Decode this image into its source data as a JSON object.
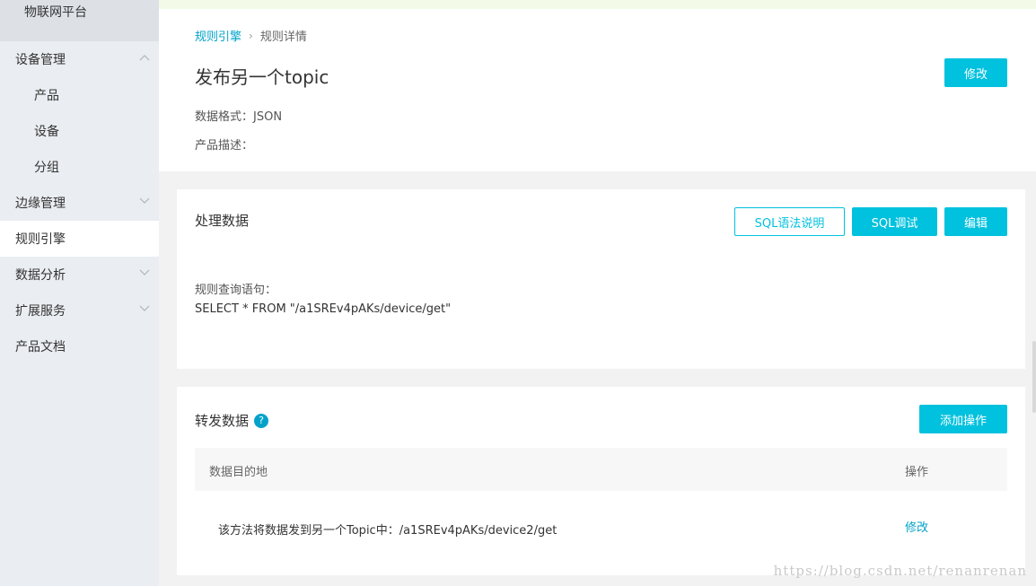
{
  "sidebar": {
    "platform_title": "物联网平台",
    "items": [
      {
        "label": "设备管理",
        "expandable": true,
        "expanded": true
      },
      {
        "label": "产品",
        "sub": true
      },
      {
        "label": "设备",
        "sub": true
      },
      {
        "label": "分组",
        "sub": true
      },
      {
        "label": "边缘管理",
        "expandable": true,
        "expanded": false
      },
      {
        "label": "规则引擎",
        "active": true
      },
      {
        "label": "数据分析",
        "expandable": true,
        "expanded": false
      },
      {
        "label": "扩展服务",
        "expandable": true,
        "expanded": false
      },
      {
        "label": "产品文档"
      }
    ]
  },
  "breadcrumb": {
    "root": "规则引擎",
    "separator": "›",
    "current": "规则详情"
  },
  "rule": {
    "title": "发布另一个topic",
    "edit_label": "修改",
    "data_format": "数据格式：JSON",
    "description": "产品描述："
  },
  "process": {
    "title": "处理数据",
    "sql_help_label": "SQL语法说明",
    "sql_debug_label": "SQL调试",
    "edit_label": "编辑",
    "query_label": "规则查询语句：",
    "query": "SELECT * FROM \"/a1SREv4pAKs/device/get\""
  },
  "forward": {
    "title": "转发数据",
    "help_glyph": "?",
    "add_label": "添加操作",
    "columns": [
      "数据目的地",
      "操作"
    ],
    "rows": [
      {
        "destination": "该方法将数据发到另一个Topic中：/a1SREv4pAKs/device2/get",
        "action": "修改"
      }
    ]
  },
  "watermark": "https://blog.csdn.net/renanrenan",
  "colors": {
    "accent": "#00c1de",
    "link": "#00a2ca",
    "sidebar_bg": "#eaedf1"
  },
  "icons": {
    "chevron_up": "chevron-up-icon",
    "chevron_down": "chevron-down-icon",
    "help": "help-circle-icon"
  }
}
